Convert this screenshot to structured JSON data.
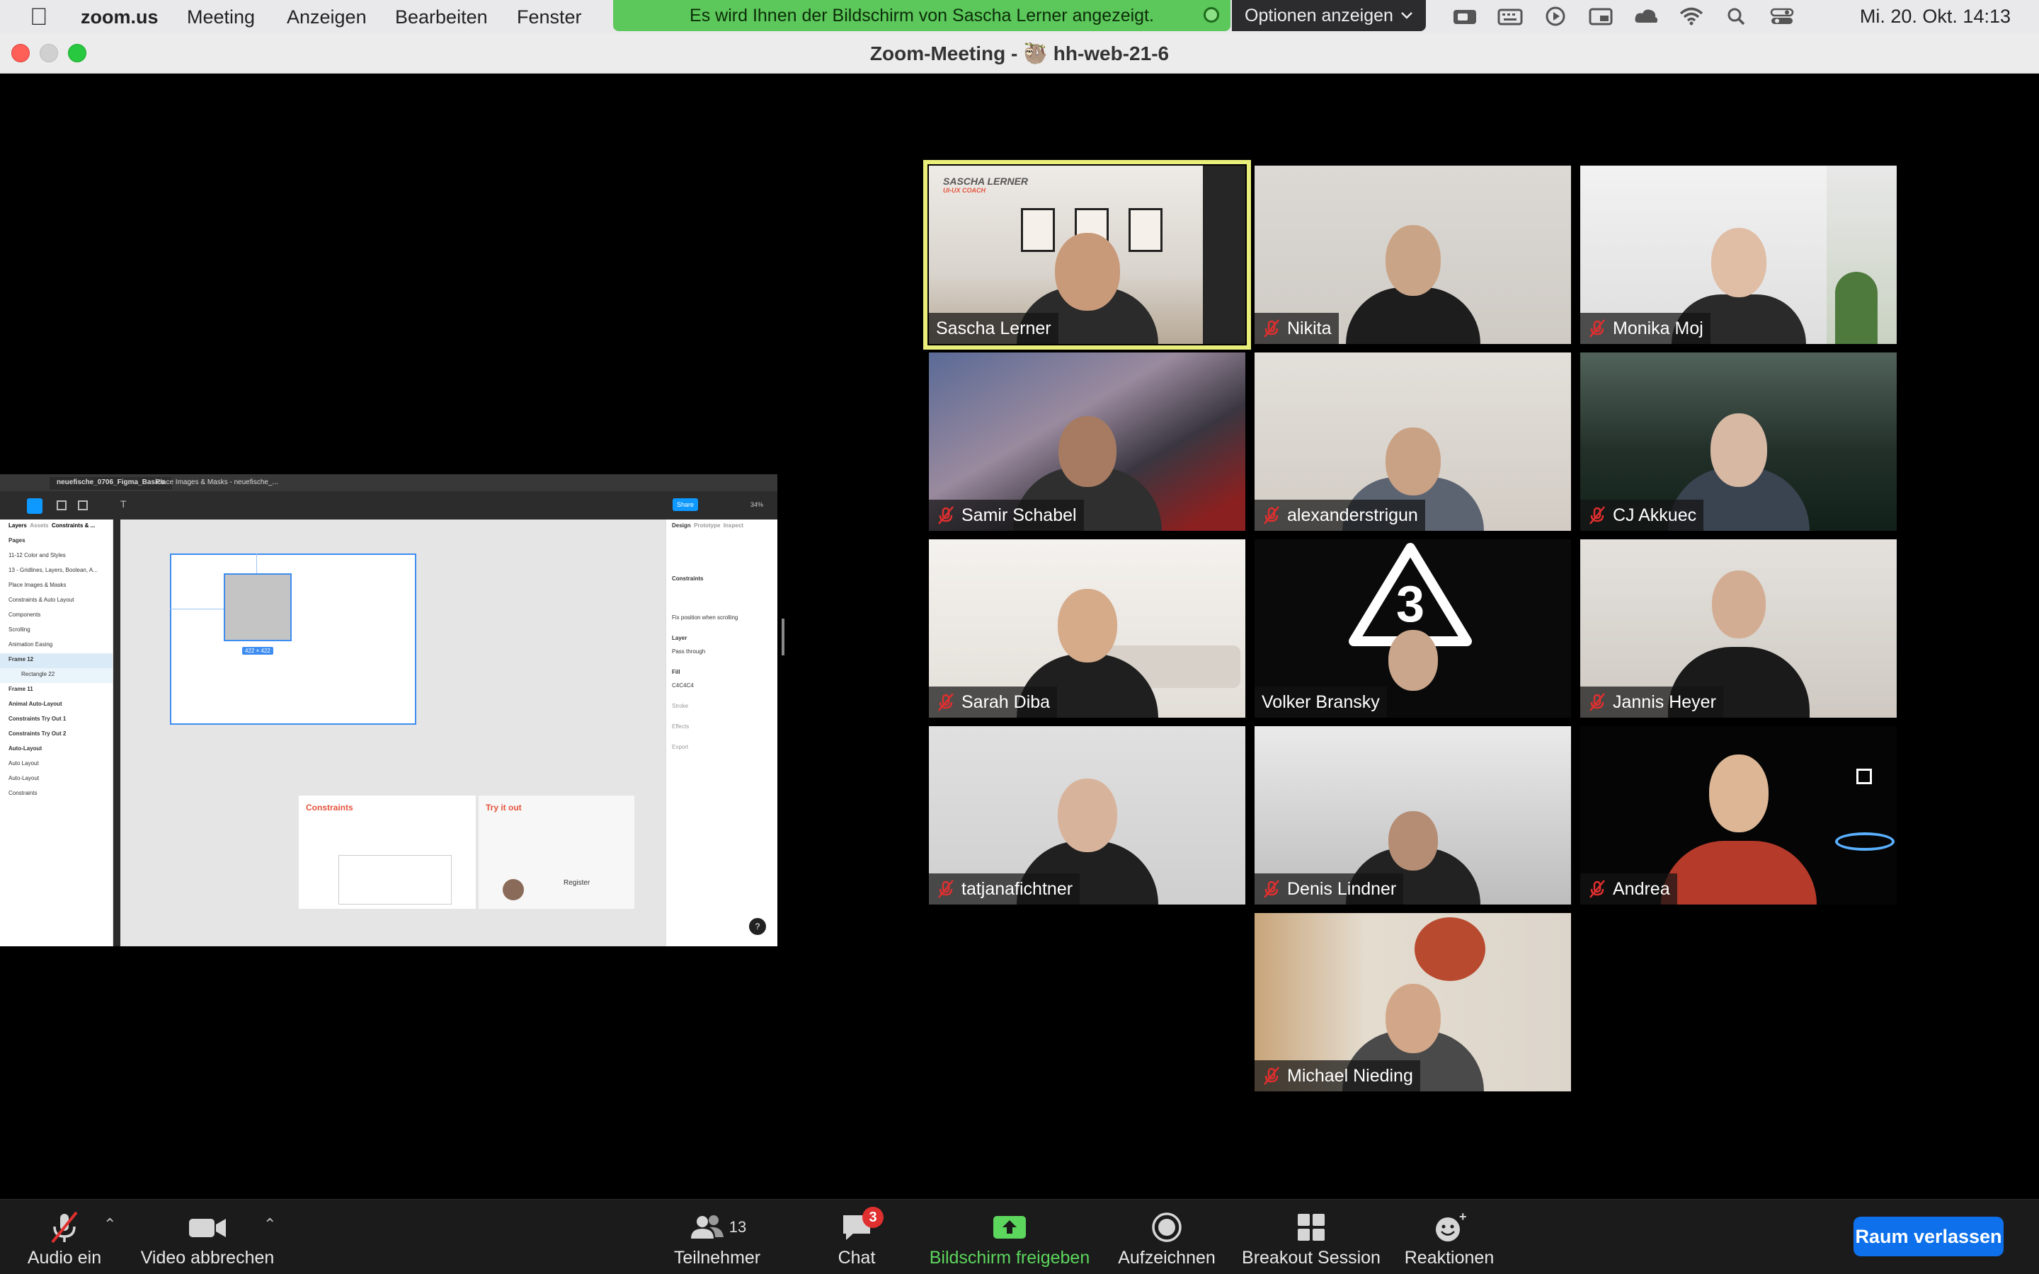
{
  "menubar": {
    "app_name": "zoom.us",
    "menus": [
      "Meeting",
      "Anzeigen",
      "Bearbeiten",
      "Fenster"
    ],
    "share_banner": "Es wird Ihnen der Bildschirm von Sascha Lerner angezeigt.",
    "view_options": "Optionen anzeigen",
    "clock": "Mi. 20. Okt.  14:13",
    "status_icons": [
      "video-camera-icon",
      "keyboard-icon",
      "play-icon",
      "picture-in-picture-icon",
      "creative-cloud-icon",
      "wifi-icon",
      "search-icon",
      "control-center-icon"
    ]
  },
  "window": {
    "title": "Zoom-Meeting - 🦥 hh-web-21-6"
  },
  "shared_screen": {
    "tabs": [
      "neuefische_0706_Figma_Basics",
      "Place Images & Masks - neuefische_..."
    ],
    "share_button": "Share",
    "zoom_level": "34%",
    "left_panel_header": [
      "Layers",
      "Assets",
      "Constraints & ..."
    ],
    "pages_label": "Pages",
    "pages": [
      "11-12 Color and Styles",
      "13 - Gridlines, Layers, Boolean, A...",
      "Place Images & Masks",
      "Constraints & Auto Layout",
      "Components",
      "Scrolling",
      "Animation Easing"
    ],
    "layers": [
      "Frame 12",
      "Rectangle 22",
      "Frame 11",
      "Animal Auto-Layout",
      "Constraints Try Out 1",
      "Constraints Try Out 2",
      "Auto-Layout",
      "Auto Layout",
      "Auto-Layout",
      "Constraints"
    ],
    "right_panel_tabs": [
      "Design",
      "Prototype",
      "Inspect"
    ],
    "right_panel_sections": [
      "Constraints",
      "Fix position when scrolling",
      "Layer",
      "Pass through",
      "Fill",
      "C4C4C4",
      "Stroke",
      "Effects",
      "Export"
    ],
    "selection_size": "422 × 422",
    "card_titles": [
      "Constraints",
      "Try it out"
    ],
    "card_button": "Register",
    "help": "?"
  },
  "participants": [
    {
      "name": "Sascha Lerner",
      "muted": false,
      "active": true,
      "overlay_text": "SASCHA LERNER",
      "overlay_sub": "UI-UX COACH"
    },
    {
      "name": "Nikita",
      "muted": true,
      "active": false
    },
    {
      "name": "Monika Moj",
      "muted": true,
      "active": false
    },
    {
      "name": "Samir Schabel",
      "muted": true,
      "active": false
    },
    {
      "name": "alexanderstrigun",
      "muted": true,
      "active": false
    },
    {
      "name": "CJ Akkuec",
      "muted": true,
      "active": false
    },
    {
      "name": "Sarah Diba",
      "muted": true,
      "active": false
    },
    {
      "name": "Volker Bransky",
      "muted": false,
      "active": false
    },
    {
      "name": "Jannis Heyer",
      "muted": true,
      "active": false
    },
    {
      "name": "tatjanafichtner",
      "muted": true,
      "active": false
    },
    {
      "name": "Denis Lindner",
      "muted": true,
      "active": false
    },
    {
      "name": "Andrea",
      "muted": true,
      "active": false
    },
    {
      "name": "Michael Nieding",
      "muted": true,
      "active": false
    }
  ],
  "controls": {
    "audio": "Audio ein",
    "video": "Video abbrechen",
    "participants": "Teilnehmer",
    "participants_count": "13",
    "chat": "Chat",
    "chat_badge": "3",
    "share": "Bildschirm freigeben",
    "record": "Aufzeichnen",
    "breakout": "Breakout Session",
    "reactions": "Reaktionen",
    "leave": "Raum verlassen"
  },
  "colors": {
    "active_speaker": "#e9ef7a",
    "share_banner": "#5cc75a",
    "share_green": "#5cd65c",
    "leave_blue": "#0e71eb",
    "mute_red": "#e02f2f"
  }
}
